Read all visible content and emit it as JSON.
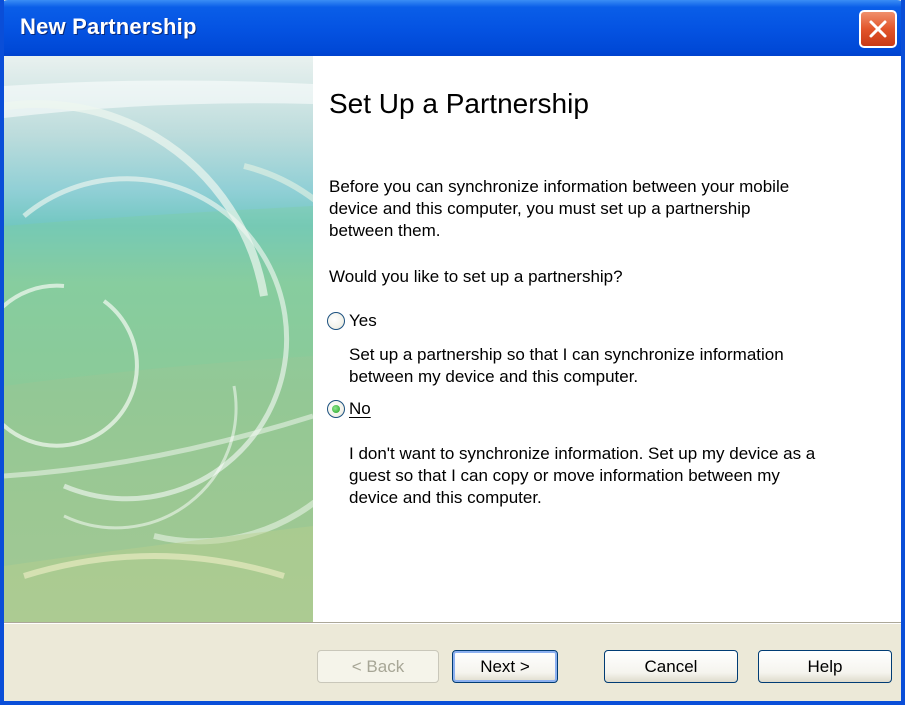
{
  "window": {
    "title": "New Partnership",
    "close_icon": "close-icon"
  },
  "page": {
    "heading": "Set Up a Partnership",
    "intro": "Before you can synchronize information between your mobile device and this computer, you must set up a partnership between them.",
    "question": "Would you like to set up a partnership?"
  },
  "options": {
    "yes": {
      "label": "Yes",
      "checked": false,
      "description": "Set up a partnership so that I can synchronize information between my device and this computer."
    },
    "no": {
      "label": "No",
      "checked": true,
      "description": "I don't want to synchronize information. Set up my device as a guest so that I can copy or move information between my device and this computer."
    }
  },
  "buttons": {
    "back": "< Back",
    "next": "Next >",
    "cancel": "Cancel",
    "help": "Help"
  },
  "colors": {
    "title_bar": "#0554e3",
    "close_button": "#e2552b",
    "dialog_face": "#ece9d8"
  }
}
